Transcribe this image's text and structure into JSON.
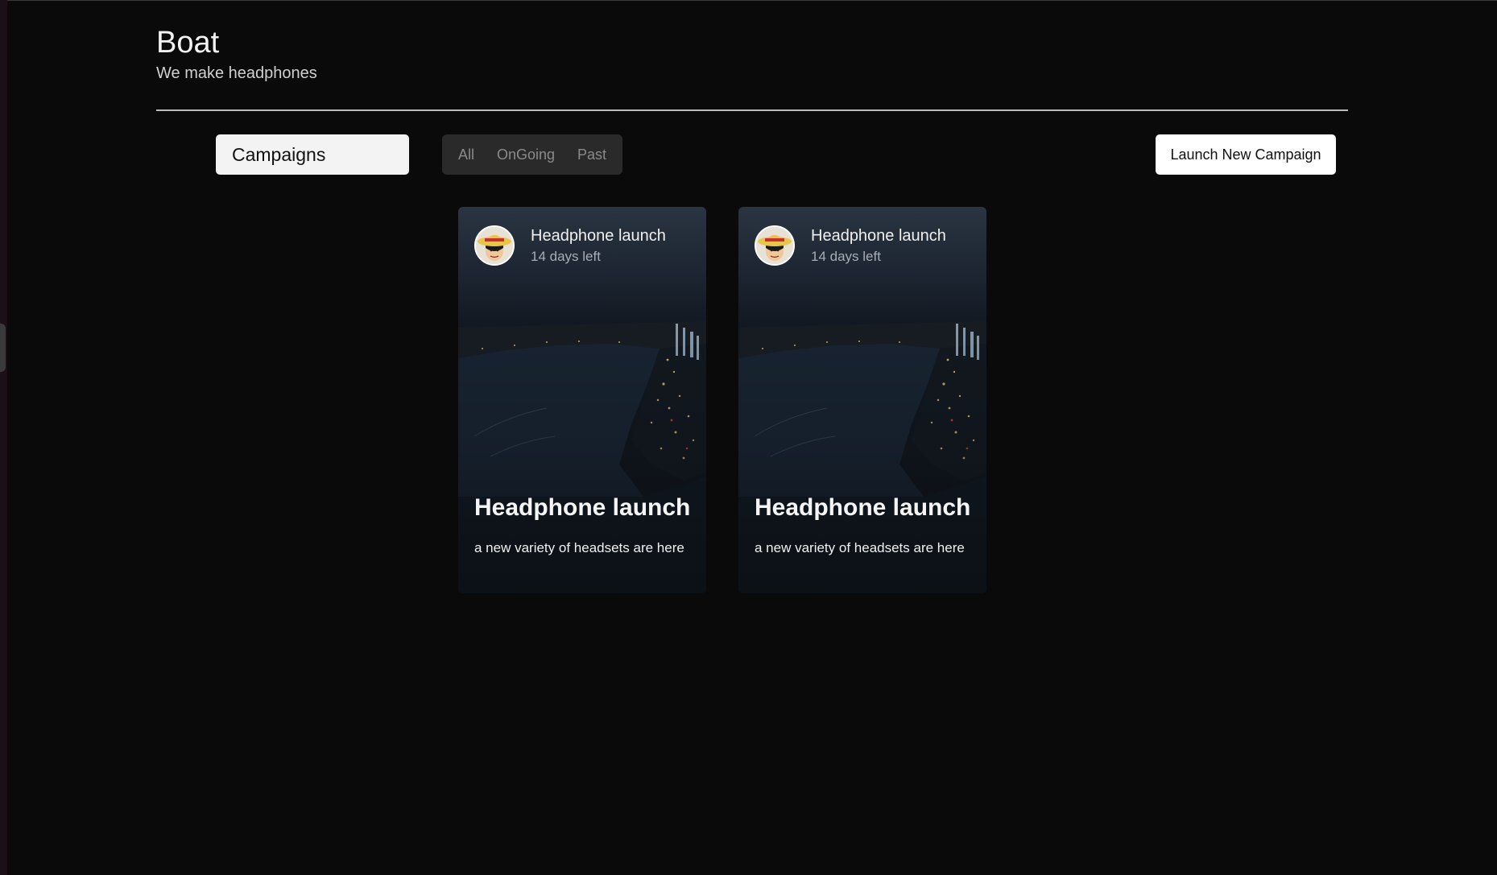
{
  "brand": {
    "title": "Boat",
    "subtitle": "We make headphones"
  },
  "toolbar": {
    "section_label": "Campaigns",
    "filters": [
      "All",
      "OnGoing",
      "Past"
    ],
    "launch_button_label": "Launch New Campaign"
  },
  "campaigns": [
    {
      "header_title": "Headphone launch",
      "status": "14 days left",
      "title": "Headphone launch",
      "description": "a new variety of headsets are here",
      "avatar_icon": "straw-hat-avatar-icon",
      "background": "night-city-river-aerial"
    },
    {
      "header_title": "Headphone launch",
      "status": "14 days left",
      "title": "Headphone launch",
      "description": "a new variety of headsets are here",
      "avatar_icon": "straw-hat-avatar-icon",
      "background": "night-city-river-aerial"
    }
  ],
  "colors": {
    "page_background": "#0a0a0a",
    "filter_group_background": "#2a2a2a",
    "filter_text": "#8a8a8a",
    "card_background": "#11161e"
  }
}
